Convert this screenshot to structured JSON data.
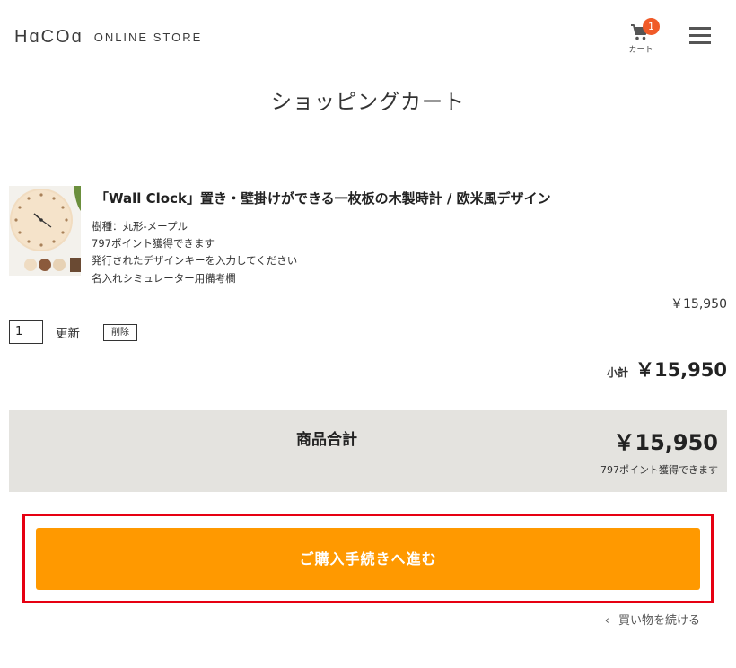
{
  "header": {
    "logo_mark": "HɑCOɑ",
    "logo_text": "ONLINE STORE",
    "cart_count": "1",
    "cart_label": "カート",
    "icons": {
      "cart": "cart-icon",
      "menu": "hamburger-menu-icon"
    }
  },
  "page": {
    "title": "ショッピングカート"
  },
  "item": {
    "title": "「Wall Clock」置き・壁掛けができる一枚板の木製時計 / 欧米風デザイン",
    "details": [
      "樹種：丸形-メープル",
      "797ポイント獲得できます",
      "発行されたデザインキーを入力してください",
      "名入れシミュレーター用備考欄"
    ],
    "unit_price": "￥15,950",
    "quantity": "1",
    "update_label": "更新",
    "delete_label": "削除",
    "subtotal_label": "小計",
    "subtotal_value": "￥15,950"
  },
  "summary": {
    "total_label": "商品合計",
    "total_value": "￥15,950",
    "points_note": "797ポイント獲得できます"
  },
  "actions": {
    "checkout_label": "ご購入手続きへ進む",
    "continue_label": "買い物を続ける",
    "continue_chevron": "‹"
  },
  "colors": {
    "checkout_button": "#ff9900",
    "highlight_frame": "#e60012",
    "cart_badge": "#f05a28",
    "summary_panel": "#e4e3df"
  }
}
